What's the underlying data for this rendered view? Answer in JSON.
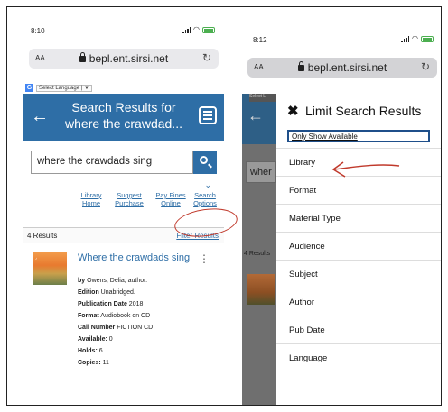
{
  "left": {
    "status": {
      "time": "8:10"
    },
    "browser": {
      "aa": "AA",
      "url": "bepl.ent.sirsi.net",
      "reload": "↻"
    },
    "translate": {
      "label": "Select Language",
      "arrow": "▼",
      "g": "G"
    },
    "header": {
      "back": "←",
      "title": "Search Results for where the crawdad..."
    },
    "search": {
      "value": "where the crawdads sing"
    },
    "links": {
      "chevron": "⌄",
      "library_home": "Library Home",
      "suggest_purchase": "Suggest Purchase",
      "pay_fines": "Pay Fines Online",
      "search_options": "Search Options"
    },
    "results": {
      "count": "4 Results",
      "filter": "Filter Results"
    },
    "item": {
      "title": "Where the crawdads sing",
      "kebab": "⋮",
      "by_label": "by",
      "author": "Owens, Delia, author.",
      "edition_label": "Edition",
      "edition": "Unabridged.",
      "pubdate_label": "Publication Date",
      "pubdate": "2018",
      "format_label": "Format",
      "format": "Audiobook on CD",
      "callnum_label": "Call Number",
      "callnum": "FICTION CD",
      "available_label": "Available:",
      "available": "0",
      "holds_label": "Holds:",
      "holds": "6",
      "copies_label": "Copies:",
      "copies": "11"
    }
  },
  "right": {
    "status": {
      "time": "8:12"
    },
    "browser": {
      "aa": "AA",
      "url": "bepl.ent.sirsi.net",
      "reload": "↻"
    },
    "background": {
      "search_fragment": "wher",
      "results_fragment": "4 Results",
      "translate_fragment": "Select L"
    },
    "drawer": {
      "close": "✖",
      "title": "Limit Search Results",
      "only_available": "Only Show Available",
      "items": [
        "Library",
        "Format",
        "Material Type",
        "Audience",
        "Subject",
        "Author",
        "Pub Date",
        "Language"
      ]
    }
  },
  "colors": {
    "header_blue": "#2e6ea6",
    "annotation_red": "#c0392b",
    "battery_green": "#4caf50"
  }
}
